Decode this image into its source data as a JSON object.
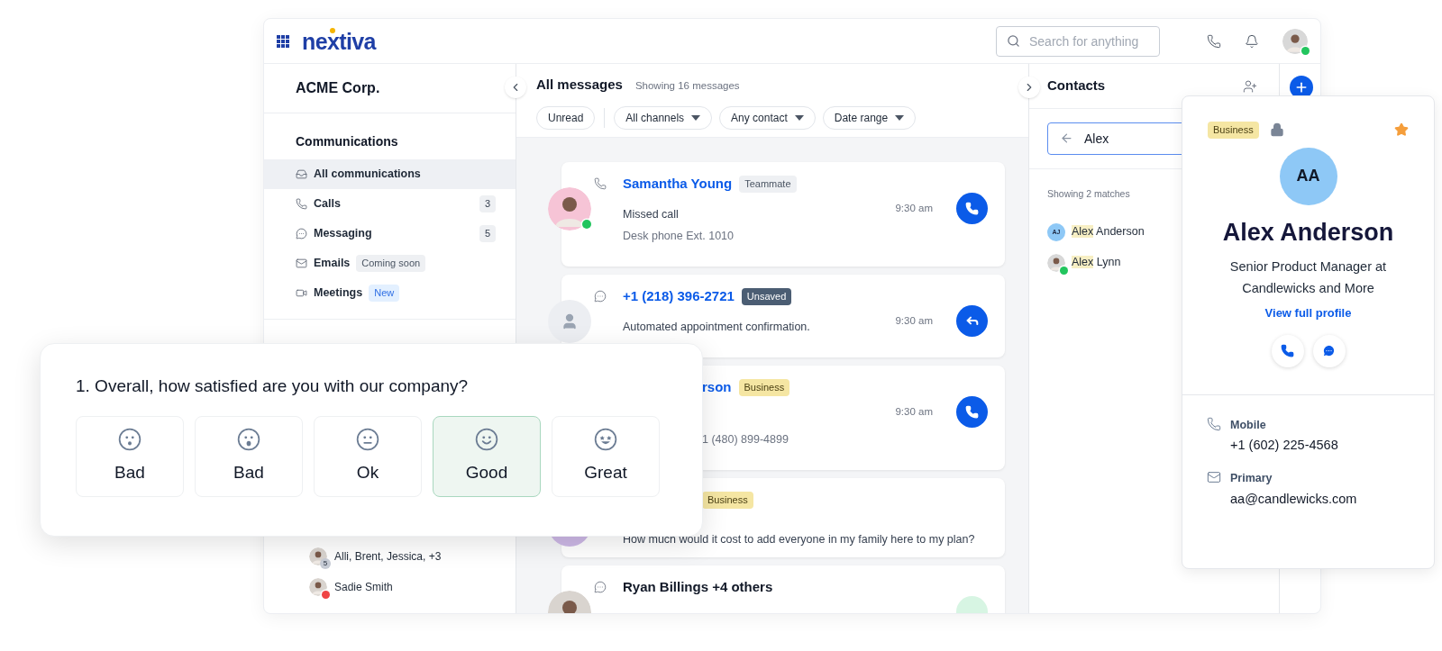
{
  "header": {
    "logo": "nextiva",
    "search_placeholder": "Search for anything",
    "user": {
      "status": {
        "color": "#22c55e"
      }
    }
  },
  "sidebar": {
    "title": "ACME Corp.",
    "section": "Communications",
    "items": [
      {
        "kind": "inbox",
        "label": "All communications",
        "selected": true
      },
      {
        "kind": "phone",
        "label": "Calls",
        "count": "3",
        "selected": false
      },
      {
        "kind": "chat",
        "label": "Messaging",
        "count": "5",
        "selected": false
      },
      {
        "kind": "mail",
        "label": "Emails",
        "tag": {
          "text": "Coming soon",
          "kind": "gray"
        },
        "selected": false
      },
      {
        "kind": "video",
        "label": "Meetings",
        "tag": {
          "text": "New",
          "kind": "blue"
        },
        "selected": false
      }
    ],
    "conversations": [
      {
        "kind": "group",
        "label": "Alli, Brent, Jessica, +3",
        "count": "5"
      },
      {
        "kind": "person",
        "label": "Sadie Smith",
        "color": "#ef4444"
      }
    ]
  },
  "messages": {
    "title": "All messages",
    "subtitle": "Showing 16 messages",
    "filters": [
      {
        "kind": "toggle",
        "label": "Unread"
      },
      {
        "kind": "dropdown",
        "label": "All channels"
      },
      {
        "kind": "dropdown",
        "label": "Any contact"
      },
      {
        "kind": "dropdown",
        "label": "Date range"
      }
    ],
    "cards": [
      {
        "kind": "full",
        "avatar": {
          "kind": "photo",
          "color": "#f6c4d6",
          "status": {
            "color": "#22c55e"
          }
        },
        "channel": {
          "kind": "phone"
        },
        "name": "Samantha Young",
        "link": true,
        "tag": {
          "text": "Teammate",
          "kind": "gray"
        },
        "line1": "Missed call",
        "line2": "Desk phone Ext. 1010",
        "time": "9:30 am",
        "action": {
          "kind": "call"
        }
      },
      {
        "kind": "full",
        "avatar": {
          "kind": "placeholder",
          "color": "#eceef2"
        },
        "channel": {
          "kind": "chat"
        },
        "name": "+1 (218) 396-2721",
        "link": true,
        "tag": {
          "text": "Unsaved",
          "kind": "dark"
        },
        "line1": "Automated appointment confirmation.",
        "time": "9:30 am",
        "action": {
          "kind": "reply"
        }
      },
      {
        "kind": "covered",
        "name": "rson",
        "link": true,
        "tag": {
          "text": "Business",
          "kind": "yellow"
        },
        "line2": "1 (480) 899-4899",
        "time": "9:30 am",
        "action": {
          "kind": "call"
        }
      },
      {
        "kind": "covered",
        "avatar": {
          "kind": "plain",
          "color": "#cdb8e6"
        },
        "tag": {
          "text": "Business",
          "kind": "yellow"
        },
        "line1": "How much would it cost to add everyone in my family here to my plan?"
      },
      {
        "kind": "full",
        "avatar": {
          "kind": "photo",
          "color": "#d9d4cf"
        },
        "channel": {
          "kind": "chat"
        },
        "name": "Ryan Billings +4 others",
        "link": false,
        "action": {
          "kind": "partial"
        }
      }
    ]
  },
  "contacts": {
    "title": "Contacts",
    "search_value": "Alex",
    "result_count": "Showing 2 matches",
    "matches": [
      {
        "avatar": {
          "kind": "initials",
          "text": "AJ"
        },
        "highlight": "Alex",
        "rest": " Anderson"
      },
      {
        "avatar": {
          "kind": "photo"
        },
        "color": "#22c55e",
        "highlight": "Alex",
        "rest": " Lynn"
      }
    ]
  },
  "contact_card": {
    "tag": "Business",
    "locked": true,
    "starred": true,
    "initials": "AA",
    "name": "Alex Anderson",
    "title": "Senior Product Manager at Candlewicks and More",
    "link": "View full profile",
    "details": [
      {
        "kind": "phone",
        "label": "Mobile",
        "value": "+1 (602) 225-4568"
      },
      {
        "kind": "mail",
        "label": "Primary",
        "value": "aa@candlewicks.com"
      }
    ]
  },
  "survey": {
    "question": "1. Overall, how satisfied are you with our company?",
    "options": [
      {
        "kind": "surprised",
        "label": "Bad",
        "selected": false
      },
      {
        "kind": "shocked",
        "label": "Bad",
        "selected": false
      },
      {
        "kind": "neutral",
        "label": "Ok",
        "selected": false
      },
      {
        "kind": "smile",
        "label": "Good",
        "selected": true
      },
      {
        "kind": "stars",
        "label": "Great",
        "selected": false
      }
    ]
  }
}
